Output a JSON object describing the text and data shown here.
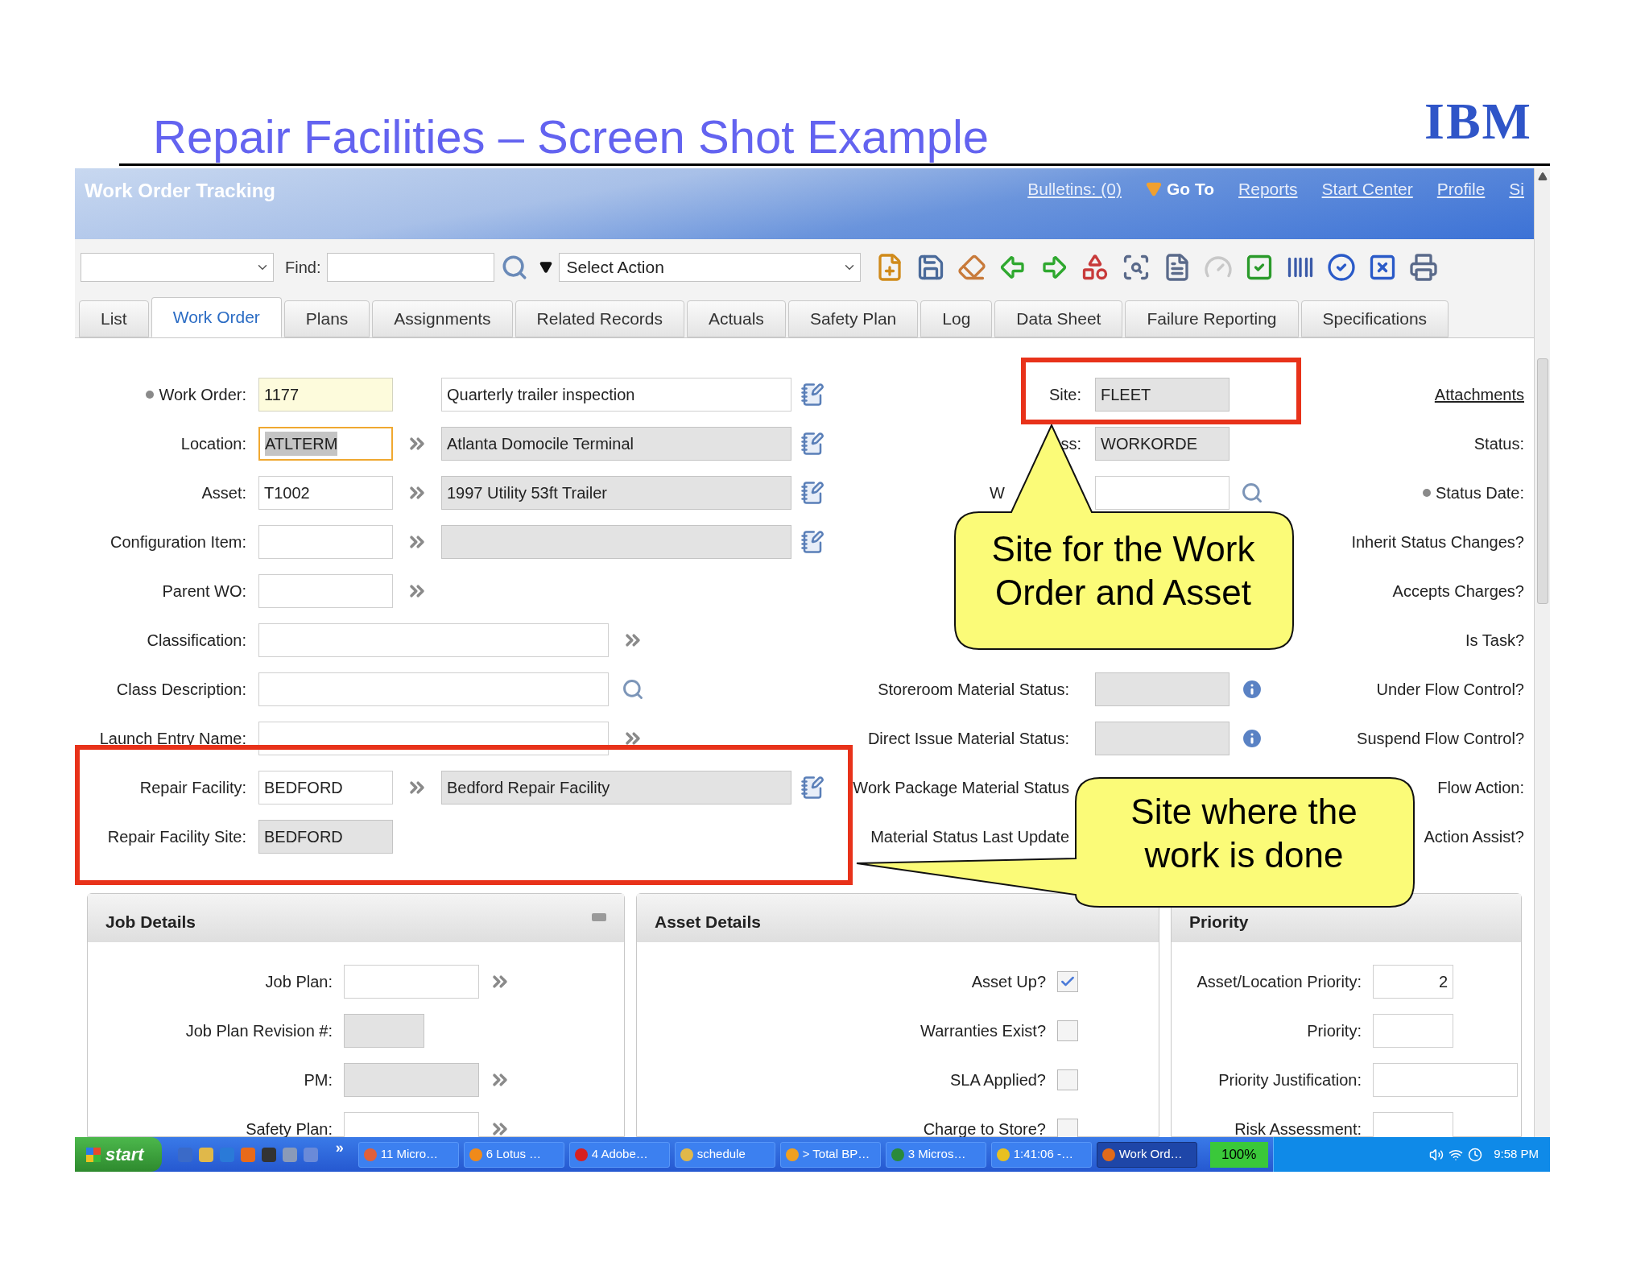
{
  "slide": {
    "title": "Repair Facilities – Screen Shot Example",
    "logo": "IBM"
  },
  "app": {
    "title": "Work Order Tracking",
    "links": [
      {
        "label": "Bulletins: (0)",
        "kind": "link"
      },
      {
        "label": "Go To",
        "kind": "menu"
      },
      {
        "label": "Reports",
        "kind": "link"
      },
      {
        "label": "Start Center",
        "kind": "link"
      },
      {
        "label": "Profile",
        "kind": "link"
      },
      {
        "label": "Si",
        "kind": "link"
      }
    ]
  },
  "toolbar": {
    "find_label": "Find:",
    "action_select": "Select Action"
  },
  "tabs": [
    {
      "label": "List",
      "selected": false
    },
    {
      "label": "Work Order",
      "selected": true
    },
    {
      "label": "Plans",
      "selected": false
    },
    {
      "label": "Assignments",
      "selected": false
    },
    {
      "label": "Related Records",
      "selected": false
    },
    {
      "label": "Actuals",
      "selected": false
    },
    {
      "label": "Safety Plan",
      "selected": false
    },
    {
      "label": "Log",
      "selected": false
    },
    {
      "label": "Data Sheet",
      "selected": false
    },
    {
      "label": "Failure Reporting",
      "selected": false
    },
    {
      "label": "Specifications",
      "selected": false
    }
  ],
  "form_left": [
    {
      "label": "Work Order:",
      "required": true,
      "kind": "short",
      "field": {
        "value": "1177",
        "kind": "required"
      },
      "description": {
        "value": "Quarterly trailer inspection",
        "readonly": false
      }
    },
    {
      "label": "Location:",
      "required": false,
      "kind": "short",
      "field": {
        "value": "ATLTERM",
        "kind": "focused"
      },
      "lookup": {
        "kind": "chevron"
      },
      "description": {
        "value": "Atlanta Domocile Terminal",
        "readonly": true
      }
    },
    {
      "label": "Asset:",
      "required": false,
      "kind": "short",
      "field": {
        "value": "T1002",
        "kind": "editable"
      },
      "lookup": {
        "kind": "chevron"
      },
      "description": {
        "value": "1997 Utility 53ft Trailer",
        "readonly": true
      }
    },
    {
      "label": "Configuration Item:",
      "required": false,
      "kind": "short",
      "field": {
        "kind": "editable"
      },
      "lookup": {
        "kind": "chevron"
      },
      "description": {
        "readonly": true
      }
    },
    {
      "label": "Parent WO:",
      "required": false,
      "kind": "short",
      "field": {
        "kind": "editable"
      },
      "lookup": {
        "kind": "chevron"
      }
    },
    {
      "label": "Classification:",
      "required": false,
      "kind": "long",
      "field": {
        "kind": "editable"
      },
      "lookup": {
        "kind": "chevron"
      }
    },
    {
      "label": "Class Description:",
      "required": false,
      "kind": "long",
      "field": {
        "kind": "editable"
      },
      "lookup": {
        "kind": "search"
      }
    },
    {
      "label": "Launch Entry Name:",
      "required": false,
      "kind": "long",
      "field": {
        "kind": "editable"
      },
      "lookup": {
        "kind": "chevron"
      }
    },
    {
      "label": "Repair Facility:",
      "required": false,
      "kind": "short",
      "field": {
        "value": "BEDFORD",
        "kind": "editable"
      },
      "lookup": {
        "kind": "chevron"
      },
      "description": {
        "value": "Bedford Repair Facility",
        "readonly": true
      }
    },
    {
      "label": "Repair Facility Site:",
      "required": false,
      "kind": "short",
      "field": {
        "value": "BEDFORD",
        "kind": "readonly"
      }
    }
  ],
  "form_middle_top": [
    {
      "label": "Site:",
      "kind": "whole",
      "field": {
        "value": "FLEET",
        "kind": "readonly"
      }
    },
    {
      "label": "ss:",
      "kind": "whole",
      "field": {
        "value": "WORKORDE",
        "kind": "readonly"
      }
    },
    {
      "label": "W",
      "kind": "cut",
      "field": {
        "kind": "editable"
      },
      "lookup": {
        "kind": "search"
      }
    }
  ],
  "form_middle_bottom": [
    {
      "label": "Storeroom Material Status:",
      "field": {
        "kind": "readonly"
      },
      "lookup": {
        "kind": "info"
      }
    },
    {
      "label": "Direct Issue Material Status:",
      "field": {
        "kind": "readonly"
      },
      "lookup": {
        "kind": "info"
      }
    },
    {
      "label": "Work Package Material Status"
    },
    {
      "label": "Material Status Last Update"
    }
  ],
  "form_right": [
    {
      "label": "Attachments",
      "kind": "link",
      "required": false
    },
    {
      "label": "Status:",
      "kind": "label",
      "required": false
    },
    {
      "label": "Status Date:",
      "kind": "label",
      "required": true
    },
    {
      "label": "Inherit Status Changes?",
      "kind": "label",
      "required": false
    },
    {
      "label": "Accepts Charges?",
      "kind": "label",
      "required": false
    },
    {
      "label": "Is Task?",
      "kind": "label",
      "required": false
    },
    {
      "label": "Under Flow Control?",
      "kind": "label",
      "required": false
    },
    {
      "label": "Suspend Flow Control?",
      "kind": "label",
      "required": false
    },
    {
      "label": "Flow Action:",
      "kind": "label",
      "required": false
    },
    {
      "label": "Action Assist?",
      "kind": "label",
      "required": false
    }
  ],
  "job_details": {
    "title": "Job Details",
    "rows": [
      {
        "label": "Job Plan:",
        "narrow": false,
        "field": {
          "kind": "editable"
        },
        "lookup": {
          "kind": "chevron"
        }
      },
      {
        "label": "Job Plan Revision #:",
        "narrow": true,
        "field": {
          "kind": "readonly"
        }
      },
      {
        "label": "PM:",
        "narrow": false,
        "field": {
          "kind": "readonly"
        },
        "lookup": {
          "kind": "chevron"
        }
      },
      {
        "label": "Safety Plan:",
        "narrow": false,
        "field": {
          "kind": "editable"
        },
        "lookup": {
          "kind": "chevron"
        }
      }
    ]
  },
  "asset_details": {
    "title": "Asset Details",
    "rows": [
      {
        "label": "Asset Up?",
        "checked": true
      },
      {
        "label": "Warranties Exist?",
        "checked": false
      },
      {
        "label": "SLA Applied?",
        "checked": false
      },
      {
        "label": "Charge to Store?",
        "checked": false
      }
    ]
  },
  "priority": {
    "title": "Priority",
    "rows": [
      {
        "label": "Asset/Location Priority:",
        "value": "2",
        "kind": "short"
      },
      {
        "label": "Priority:",
        "kind": "short"
      },
      {
        "label": "Priority Justification:",
        "kind": "wide"
      },
      {
        "label": "Risk Assessment:",
        "kind": "short"
      }
    ]
  },
  "callouts": [
    "Site for the Work Order and Asset",
    "Site where the work is done"
  ],
  "taskbar": {
    "start": "start",
    "more": "»",
    "tasks": [
      {
        "label": "11 Micro…",
        "selected": false
      },
      {
        "label": "6 Lotus …",
        "selected": false
      },
      {
        "label": "4 Adobe…",
        "selected": false
      },
      {
        "label": "schedule",
        "selected": false
      },
      {
        "label": "> Total BP…",
        "selected": false
      },
      {
        "label": "3 Micros…",
        "selected": false
      },
      {
        "label": "1:41:06 -…",
        "selected": false
      },
      {
        "label": "Work Ord…",
        "selected": true
      }
    ],
    "zoom": "100%",
    "clock": "9:58 PM"
  }
}
